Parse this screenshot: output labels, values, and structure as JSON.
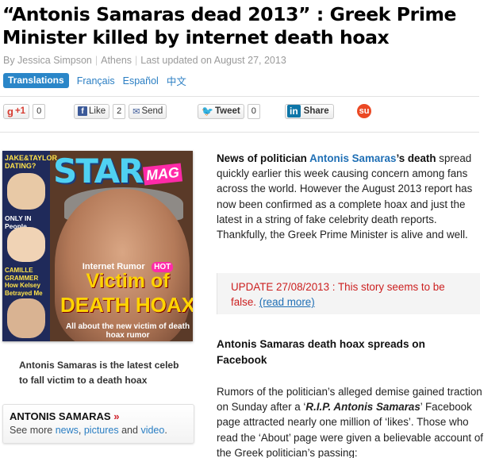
{
  "headline": "“Antonis Samaras dead 2013” : Greek Prime Minister killed by internet death hoax",
  "byline": {
    "author": "By Jessica Simpson",
    "location": "Athens",
    "updated": "Last updated on August 27, 2013"
  },
  "translations": {
    "label": "Translations",
    "languages": [
      "Français",
      "Español",
      "中文"
    ]
  },
  "social": {
    "gplus": {
      "label": "+1",
      "count": "0"
    },
    "facebook": {
      "like_label": "Like",
      "count": "2",
      "send_label": "Send"
    },
    "twitter": {
      "label": "Tweet",
      "count": "0"
    },
    "linkedin": {
      "logo": "in",
      "label": "Share"
    },
    "stumbleupon": {
      "icon": "stumbleupon-icon"
    }
  },
  "cover": {
    "logo": "STAR",
    "logo_suffix": "MAG",
    "side1": "JAKE&TAYLOR DATING?",
    "side2": "ONLY IN People",
    "side3": "CAMILLE GRAMMER How Kelsey Betrayed Me",
    "rumor": "Internet Rumor",
    "hot": "HOT",
    "victim": "Victim of",
    "death_hoax": "DEATH HOAX",
    "tagline": "All about the new victim of death hoax rumor"
  },
  "caption": "Antonis Samaras is the latest celeb to fall victim to a death hoax",
  "tag_box": {
    "title": "ANTONIS SAMARAS",
    "raquo": "»",
    "see_more": "See more",
    "news": "news",
    "pictures": "pictures",
    "and": "and",
    "video": "video",
    "comma": ",",
    "period": "."
  },
  "article": {
    "lead_start": "News of politician ",
    "lead_name": "Antonis Samaras",
    "lead_end": "’s death",
    "body": " spread quickly earlier this week causing concern among fans across the world. However the August 2013 report has now been confirmed as a complete hoax and just the latest in a string of fake celebrity death reports. Thankfully, the Greek Prime Minister is alive and well."
  },
  "update": {
    "text": "UPDATE 27/08/2013 : This story seems to be false.",
    "read_more": "(read more)"
  },
  "subhead": "Antonis Samaras death hoax spreads on Facebook",
  "para2": {
    "start": "Rumors of the politician’s alleged demise gained traction on Sunday after a ‘",
    "rip": "R.I.P. Antonis Samaras",
    "end": "’ Facebook page attracted nearly one million of ‘likes’. Those who read the ‘About’ page were given a believable account of the Greek politician’s passing:"
  }
}
